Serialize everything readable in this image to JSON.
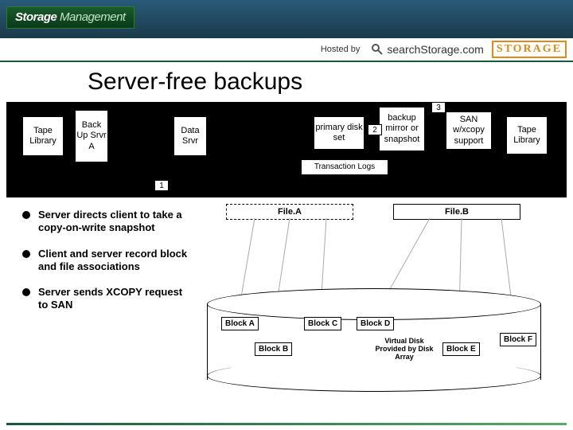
{
  "header": {
    "logo_bold": "Storage",
    "logo_light": "Management",
    "hosted_by": "Hosted by",
    "search_label": "searchStorage.com",
    "storage_pill": "STORAGE"
  },
  "title": "Server-free backups",
  "diagram_top": {
    "boxes": {
      "tape1": "Tape\nLibrary",
      "backup_srvr": "Back\nUp\nSrvr\nA",
      "data_srvr": "Data\nSrvr",
      "primary_disk": "primary\ndisk set",
      "backup_mirror": "backup\nmirror\nor\nsnapshot",
      "san": "SAN\nw/xcopy\nsupport",
      "tape2": "Tape\nLibrary",
      "txlogs": "Transaction Logs"
    },
    "nums": {
      "one": "1",
      "two": "2",
      "three": "3"
    }
  },
  "bullets": [
    "Server directs client to take a copy-on-write snapshot",
    "Client and server record block and file associations",
    "Server sends XCOPY request to SAN"
  ],
  "diagram_bottom": {
    "file_a": "File.A",
    "file_b": "File.B",
    "blocks": {
      "a": "Block A",
      "b": "Block B",
      "c": "Block C",
      "d": "Block D",
      "e": "Block E",
      "f": "Block F"
    },
    "vdisk": "Virtual Disk\nProvided by\nDisk Array"
  }
}
